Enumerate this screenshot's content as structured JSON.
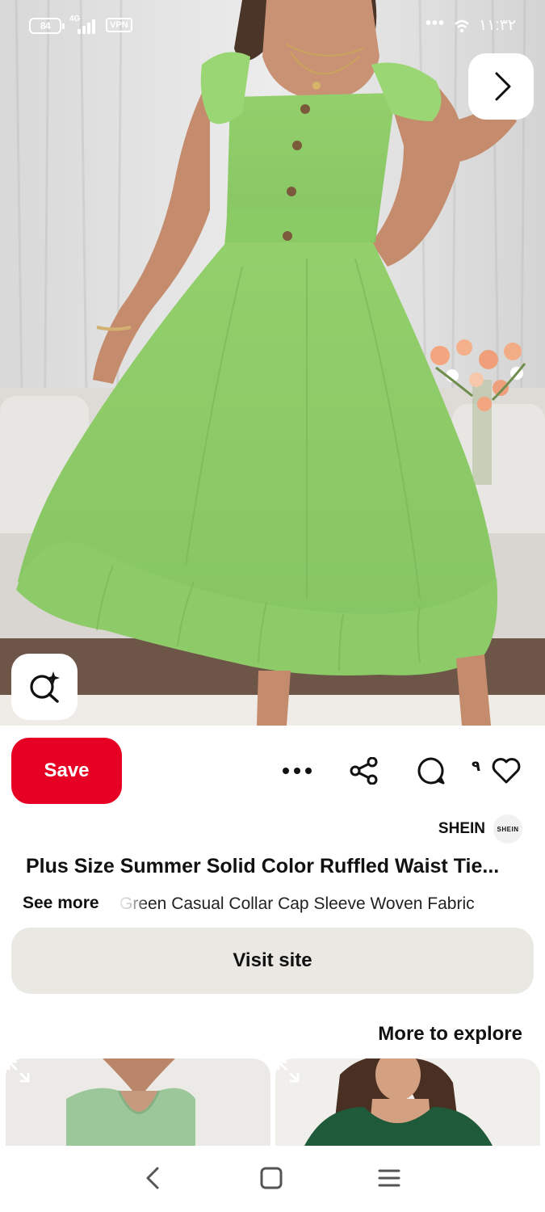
{
  "status_bar": {
    "battery": "84",
    "network": "4G",
    "vpn": "VPN",
    "more": "•••",
    "time": "١١:٣٢"
  },
  "pin": {
    "save_label": "Save",
    "like_count": "٩",
    "source_name": "SHEIN",
    "source_logo_text": "SHEIN",
    "title": "Plus Size Summer Solid Color Ruffled Waist Tie...",
    "see_more_label": "See more",
    "description": "Green Casual Collar Cap Sleeve Woven Fabric",
    "visit_label": "Visit site"
  },
  "explore": {
    "heading": "More to explore"
  },
  "colors": {
    "save_red": "#e60023",
    "visit_bg": "#e9e8e2",
    "dress_green": "#8fcf6a"
  },
  "icons": {
    "next": "chevron-right-icon",
    "lens": "visual-search-icon",
    "more": "ellipsis-icon",
    "share": "share-icon",
    "comment": "comment-icon",
    "like": "heart-icon",
    "expand": "expand-icon",
    "nav_back": "back-icon",
    "nav_home": "home-icon",
    "nav_menu": "menu-icon"
  }
}
